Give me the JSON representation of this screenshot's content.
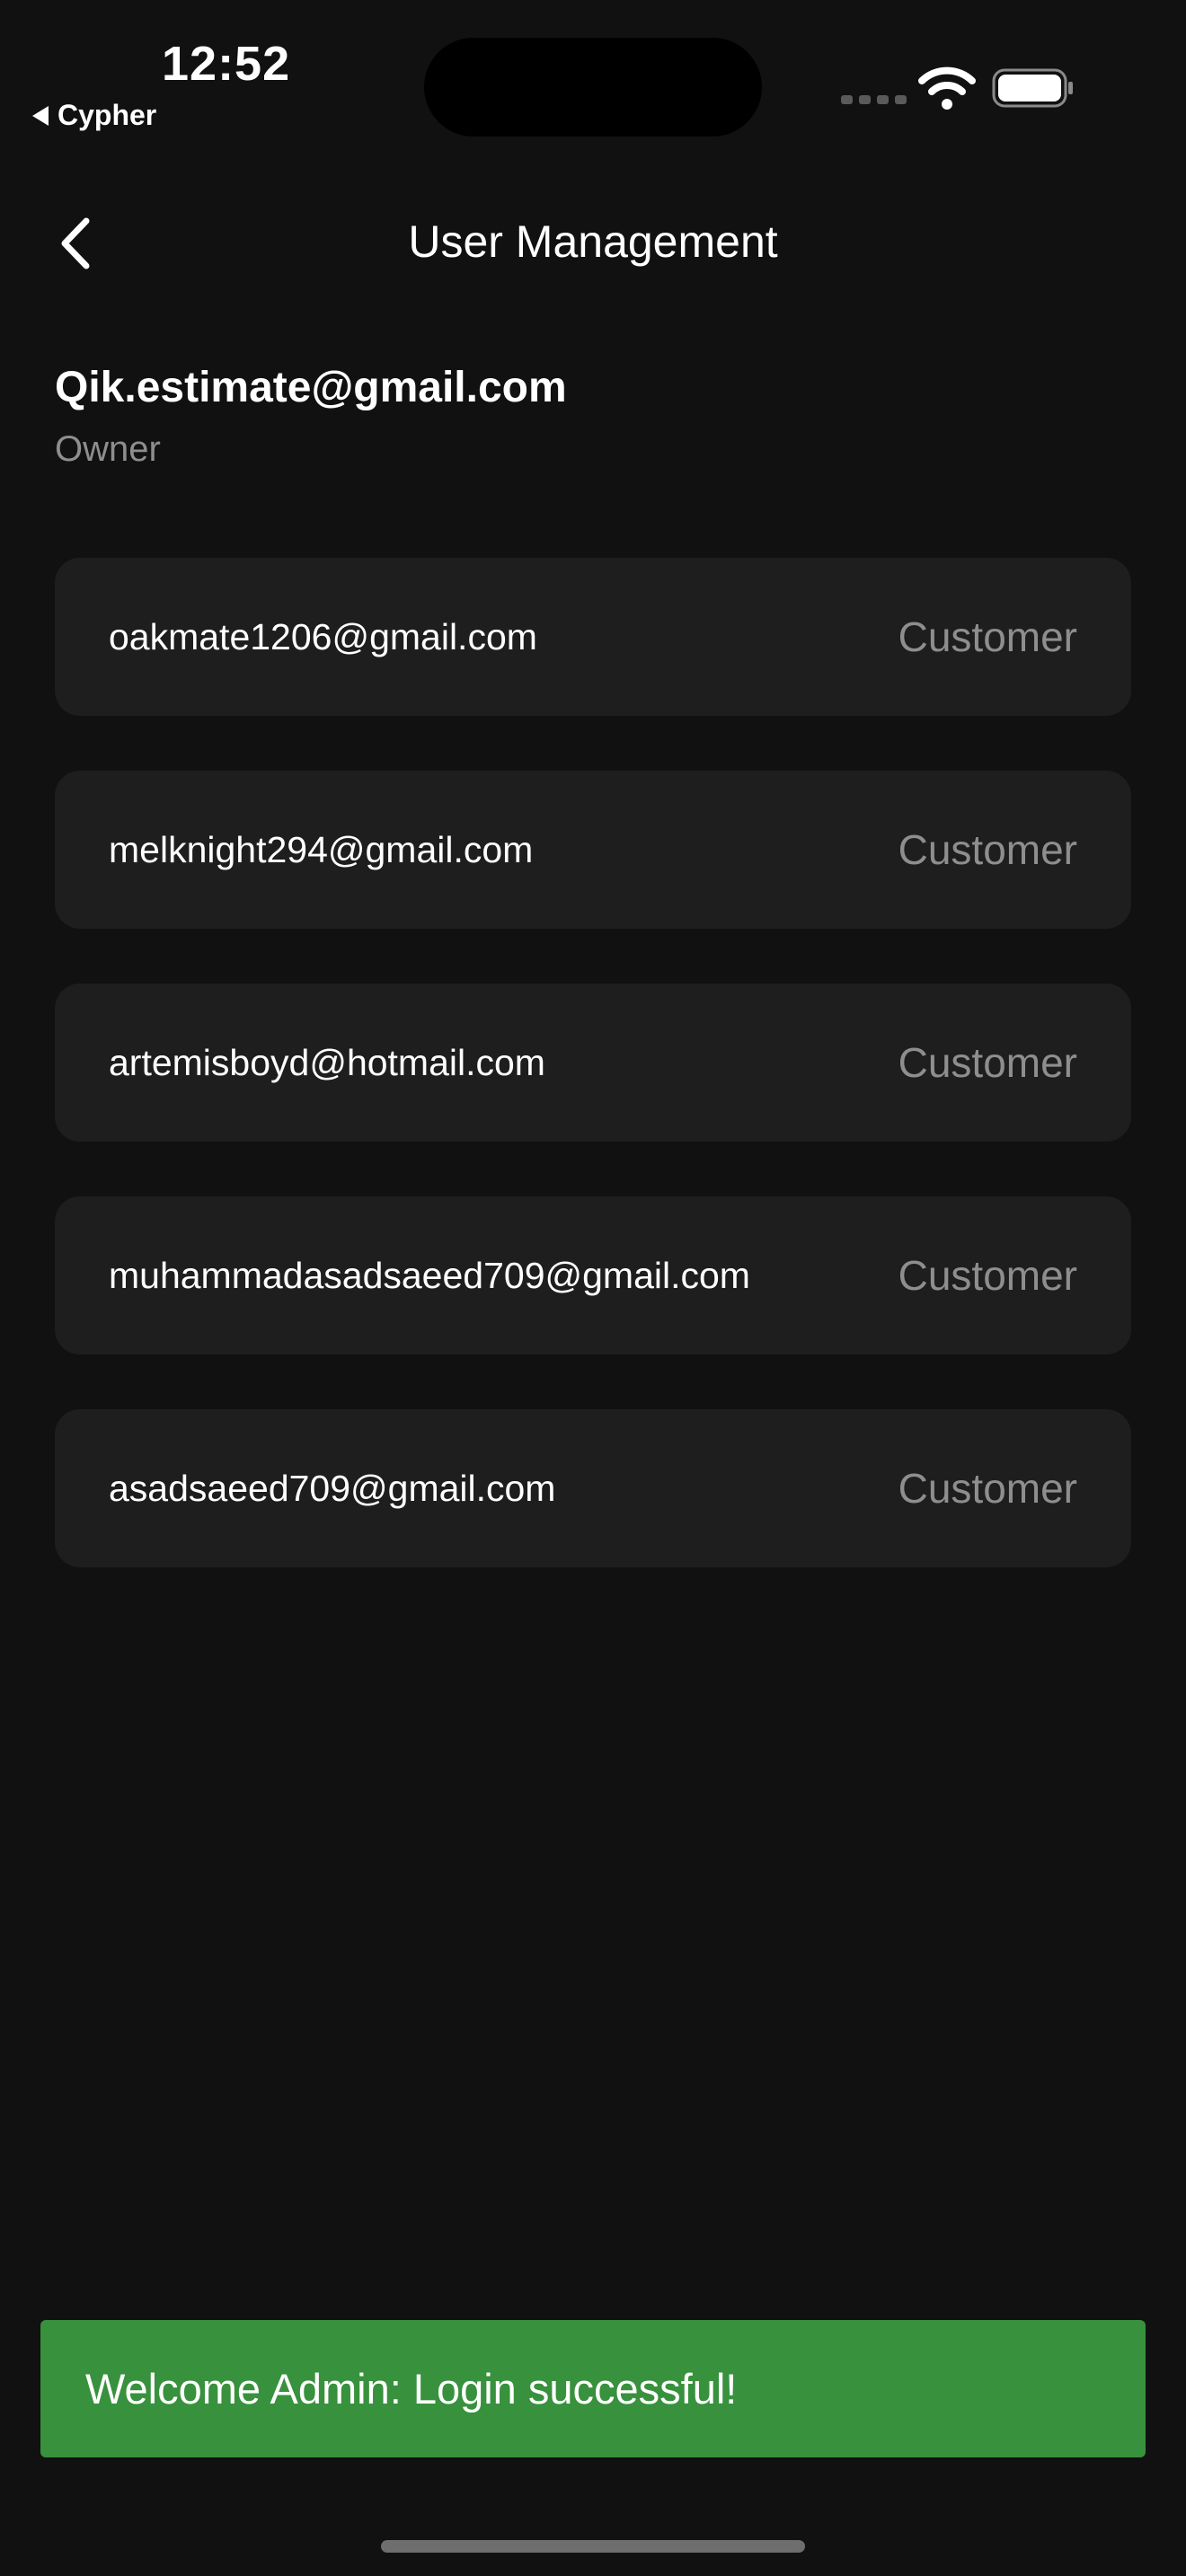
{
  "status_bar": {
    "time": "12:52",
    "back_app": "Cypher",
    "icons": [
      "cellular-dots-icon",
      "wifi-icon",
      "battery-icon"
    ]
  },
  "header": {
    "title": "User Management",
    "back_icon": "chevron-left-icon"
  },
  "owner": {
    "email": "Qik.estimate@gmail.com",
    "role": "Owner"
  },
  "users": [
    {
      "email": "oakmate1206@gmail.com",
      "role": "Customer"
    },
    {
      "email": "melknight294@gmail.com",
      "role": "Customer"
    },
    {
      "email": "artemisboyd@hotmail.com",
      "role": "Customer"
    },
    {
      "email": "muhammadasadsaeed709@gmail.com",
      "role": "Customer"
    },
    {
      "email": "asadsaeed709@gmail.com",
      "role": "Customer"
    }
  ],
  "toast": {
    "message": "Welcome Admin: Login successful!"
  },
  "colors": {
    "background": "#111111",
    "card": "#1e1e1e",
    "muted_text": "#8e8e8e",
    "toast_green": "#38913d"
  }
}
